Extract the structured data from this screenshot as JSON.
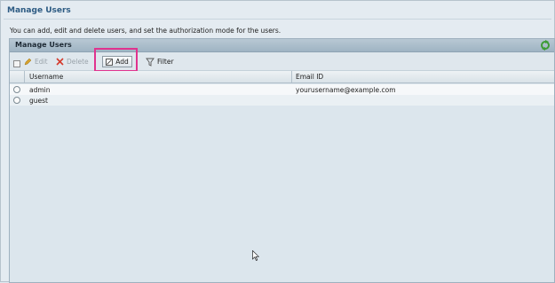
{
  "page": {
    "title": "Manage Users",
    "description": "You can add, edit and delete users, and set the authorization mode for the users."
  },
  "panel": {
    "title": "Manage Users"
  },
  "toolbar": {
    "edit_label": "Edit",
    "delete_label": "Delete",
    "add_label": "Add",
    "filter_label": "Filter"
  },
  "table": {
    "columns": [
      "Username",
      "Email ID"
    ],
    "rows": [
      {
        "username": "admin",
        "email": "yourusername@example.com"
      },
      {
        "username": "guest",
        "email": ""
      }
    ]
  },
  "colors": {
    "title": "#2d5b83",
    "highlight": "#e0338e",
    "panel_header": "#a9bccb"
  },
  "icons": [
    "pencil-icon",
    "delete-x-icon",
    "add-icon",
    "filter-icon",
    "refresh-icon",
    "mouse-cursor-icon"
  ]
}
